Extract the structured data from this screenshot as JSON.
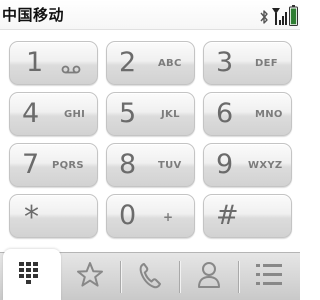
{
  "status_bar": {
    "carrier": "中国移动",
    "icons": [
      "bluetooth-icon",
      "signal-icon",
      "battery-icon"
    ]
  },
  "keypad": {
    "keys": [
      {
        "digit": "1",
        "letters": "",
        "sub_icon": "voicemail-icon"
      },
      {
        "digit": "2",
        "letters": "ABC"
      },
      {
        "digit": "3",
        "letters": "DEF"
      },
      {
        "digit": "4",
        "letters": "GHI"
      },
      {
        "digit": "5",
        "letters": "JKL"
      },
      {
        "digit": "6",
        "letters": "MNO"
      },
      {
        "digit": "7",
        "letters": "PQRS"
      },
      {
        "digit": "8",
        "letters": "TUV"
      },
      {
        "digit": "9",
        "letters": "WXYZ"
      },
      {
        "digit": "*",
        "letters": ""
      },
      {
        "digit": "0",
        "letters": "+"
      },
      {
        "digit": "#",
        "letters": ""
      }
    ]
  },
  "tabbar": {
    "tabs": [
      {
        "icon": "dialpad-icon",
        "active": true
      },
      {
        "icon": "star-icon",
        "active": false
      },
      {
        "icon": "phone-handset-icon",
        "active": false
      },
      {
        "icon": "contact-person-icon",
        "active": false
      },
      {
        "icon": "list-icon",
        "active": false
      }
    ]
  },
  "colors": {
    "key_text": "#6b6b6b",
    "key_letters": "#7c7c7c",
    "battery_fill": "#2e7d32",
    "tab_icon": "#888888"
  }
}
